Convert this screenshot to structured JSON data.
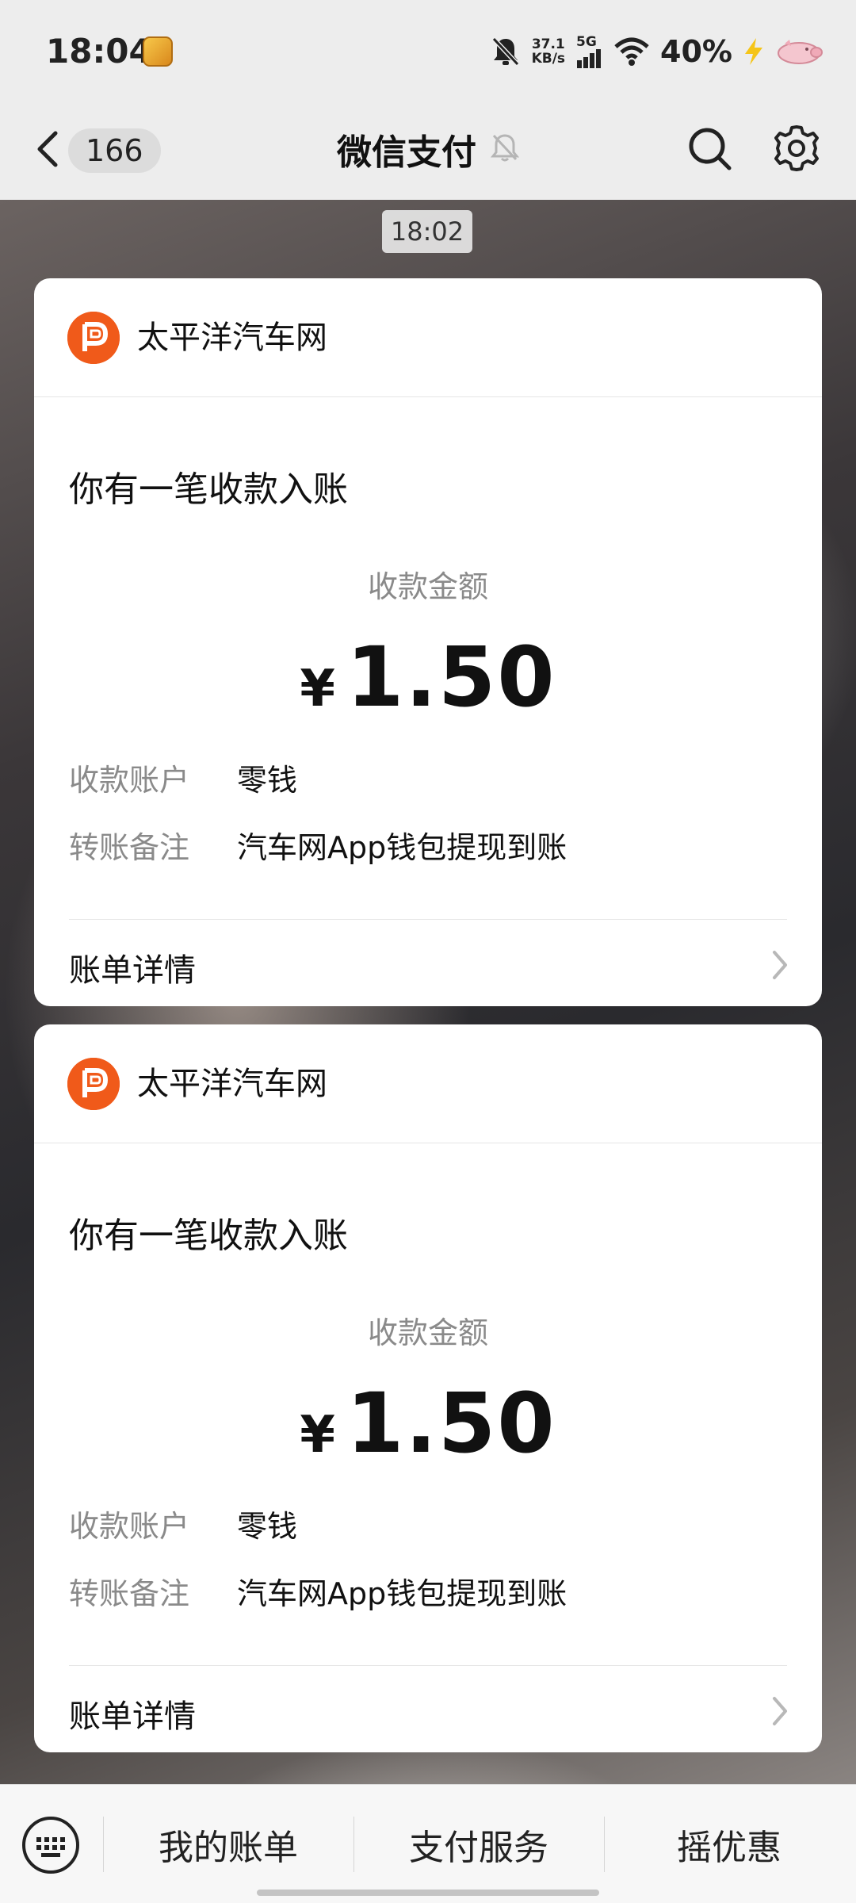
{
  "status_bar": {
    "time": "18:04",
    "net_speed_value": "37.1",
    "net_speed_unit": "KB/s",
    "network_type": "5G",
    "battery": "40%",
    "app_icon": "game-app-icon",
    "icons": [
      "mute-icon",
      "signal-icon",
      "wifi-icon",
      "charging-icon",
      "pig-icon"
    ]
  },
  "title_bar": {
    "back_count": "166",
    "title": "微信支付",
    "icons": [
      "back-icon",
      "muted-bell-icon",
      "search-icon",
      "gear-icon"
    ]
  },
  "timestamp": "18:02",
  "cards": [
    {
      "merchant": "太平洋汽车网",
      "logo": "pacific-auto-logo",
      "heading": "你有一笔收款入账",
      "amount_label": "收款金额",
      "currency": "¥",
      "amount": "1.50",
      "rows": [
        {
          "key": "收款账户",
          "value": "零钱"
        },
        {
          "key": "转账备注",
          "value": "汽车网App钱包提现到账"
        }
      ],
      "detail_label": "账单详情"
    },
    {
      "merchant": "太平洋汽车网",
      "logo": "pacific-auto-logo",
      "heading": "你有一笔收款入账",
      "amount_label": "收款金额",
      "currency": "¥",
      "amount": "1.50",
      "rows": [
        {
          "key": "收款账户",
          "value": "零钱"
        },
        {
          "key": "转账备注",
          "value": "汽车网App钱包提现到账"
        }
      ],
      "detail_label": "账单详情"
    }
  ],
  "bottom_menu": {
    "items": [
      "我的账单",
      "支付服务",
      "摇优惠"
    ],
    "keyboard_icon": "keyboard-icon"
  },
  "colors": {
    "brand_orange": "#f05a1a",
    "charging_yellow": "#f5c518",
    "page_bg": "#ededed"
  }
}
